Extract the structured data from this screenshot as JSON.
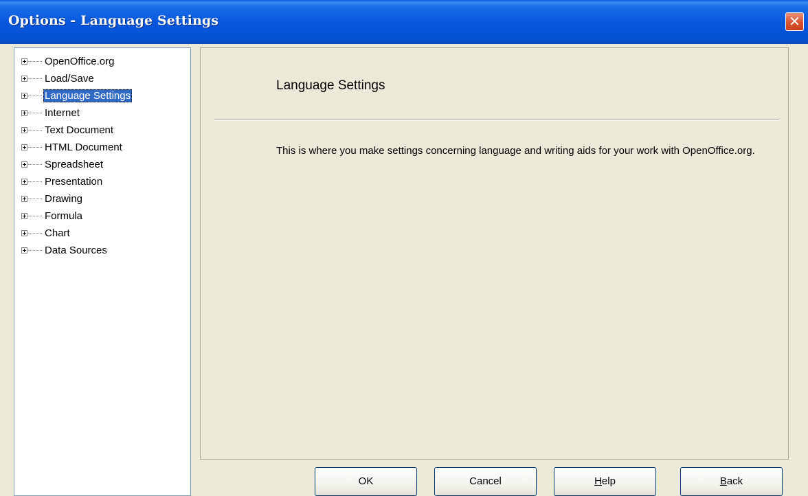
{
  "window": {
    "title": "Options - Language Settings"
  },
  "tree": {
    "items": [
      {
        "label": "OpenOffice.org"
      },
      {
        "label": "Load/Save"
      },
      {
        "label": "Language Settings",
        "selected": true
      },
      {
        "label": "Internet"
      },
      {
        "label": "Text Document"
      },
      {
        "label": "HTML Document"
      },
      {
        "label": "Spreadsheet"
      },
      {
        "label": "Presentation"
      },
      {
        "label": "Drawing"
      },
      {
        "label": "Formula"
      },
      {
        "label": "Chart"
      },
      {
        "label": "Data Sources"
      }
    ]
  },
  "content": {
    "title": "Language Settings",
    "description": "This is where you make settings concerning language and writing aids for your work with OpenOffice.org."
  },
  "buttons": {
    "ok": "OK",
    "cancel": "Cancel",
    "help_mnemonic": "H",
    "help_rest": "elp",
    "back_mnemonic": "B",
    "back_rest": "ack"
  },
  "colors": {
    "titlebar": "#0858dd",
    "selection": "#316ac5",
    "dialog_bg": "#ece9d8",
    "close_button": "#d9532e"
  }
}
